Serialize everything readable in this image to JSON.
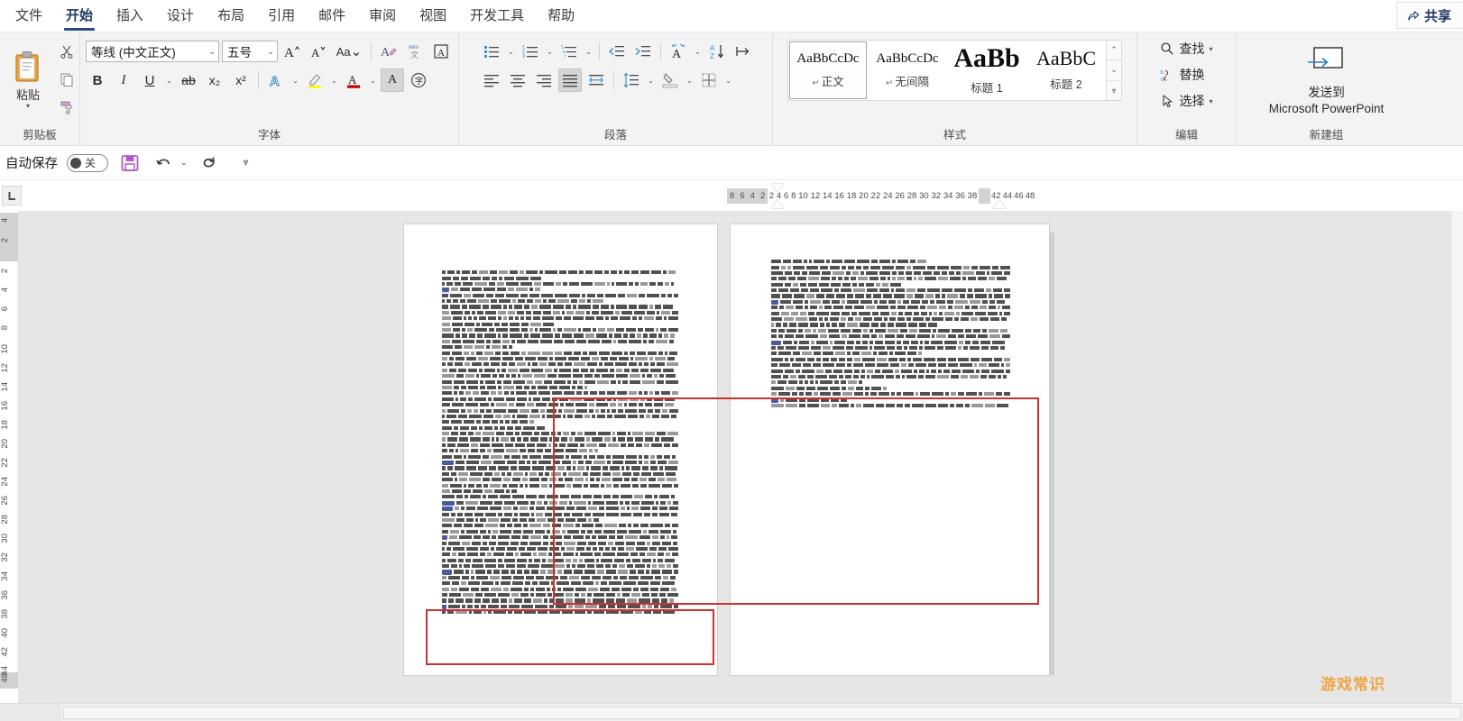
{
  "window": {
    "share_label": "共享"
  },
  "tabs": [
    {
      "label": "文件",
      "active": false
    },
    {
      "label": "开始",
      "active": true
    },
    {
      "label": "插入",
      "active": false
    },
    {
      "label": "设计",
      "active": false
    },
    {
      "label": "布局",
      "active": false
    },
    {
      "label": "引用",
      "active": false
    },
    {
      "label": "邮件",
      "active": false
    },
    {
      "label": "审阅",
      "active": false
    },
    {
      "label": "视图",
      "active": false
    },
    {
      "label": "开发工具",
      "active": false
    },
    {
      "label": "帮助",
      "active": false
    }
  ],
  "ribbon": {
    "clipboard": {
      "group_label": "剪贴板",
      "paste_label": "粘贴",
      "cut_icon": "scissors-icon",
      "copy_icon": "copy-icon",
      "format_painter_icon": "format-painter-icon"
    },
    "font": {
      "group_label": "字体",
      "font_name": "等线 (中文正文)",
      "font_size": "五号",
      "grow_font": "A▲",
      "shrink_font": "A▼",
      "change_case": "Aa",
      "clear_formatting_icon": "clear-formatting-icon",
      "phonetic_guide_icon": "phonetic-guide-icon",
      "character_border_icon": "character-border-icon",
      "bold": "B",
      "italic": "I",
      "underline": "U",
      "strikethrough": "ab",
      "subscript": "x₂",
      "superscript": "x²",
      "text_effects_icon": "text-effects-icon",
      "highlight_icon": "highlight-icon",
      "font_color_icon": "font-color-icon",
      "font_color_hex": "#C00000",
      "highlight_hex": "#FFFF00",
      "shading_icon": "character-shading-icon",
      "enclose_char_icon": "enclose-character-icon"
    },
    "paragraph": {
      "group_label": "段落",
      "bullets_icon": "bullet-list-icon",
      "numbering_icon": "numbered-list-icon",
      "multilevel_icon": "multilevel-list-icon",
      "decrease_indent_icon": "decrease-indent-icon",
      "increase_indent_icon": "increase-indent-icon",
      "chinese_layout_icon": "chinese-layout-icon",
      "sort_icon": "sort-icon",
      "show_marks_icon": "show-formatting-marks-icon",
      "align_left_icon": "align-left-icon",
      "align_center_icon": "align-center-icon",
      "align_right_icon": "align-right-icon",
      "justify_icon": "justify-icon",
      "distribute_icon": "distribute-icon",
      "line_spacing_icon": "line-spacing-icon",
      "shading_icon": "paragraph-shading-icon",
      "borders_icon": "borders-icon",
      "active_alignment": "justify"
    },
    "styles": {
      "group_label": "样式",
      "items": [
        {
          "preview": "AaBbCcDc",
          "name": "正文",
          "pilcrow": "↵",
          "selected": true,
          "size": "15px",
          "weight": "normal"
        },
        {
          "preview": "AaBbCcDc",
          "name": "无间隔",
          "pilcrow": "↵",
          "selected": false,
          "size": "15px",
          "weight": "normal"
        },
        {
          "preview": "AaBb",
          "name": "标题 1",
          "pilcrow": "",
          "selected": false,
          "size": "30px",
          "weight": "bold"
        },
        {
          "preview": "AaBbC",
          "name": "标题 2",
          "pilcrow": "",
          "selected": false,
          "size": "22px",
          "weight": "normal"
        }
      ]
    },
    "editing": {
      "group_label": "编辑",
      "find": "查找",
      "replace": "替换",
      "select": "选择"
    },
    "newgroup": {
      "group_label": "新建组",
      "send_to_line1": "发送到",
      "send_to_line2": "Microsoft PowerPoint",
      "icon": "send-to-powerpoint-icon"
    }
  },
  "quick_access": {
    "autosave_label": "自动保存",
    "autosave_state": "关",
    "save_icon": "save-icon",
    "save_color": "#B05BC9",
    "undo_icon": "undo-icon",
    "redo_icon": "redo-icon",
    "customize_icon": "customize-qat-icon"
  },
  "ruler": {
    "tab_stop_icon": "left-tab-stop-icon",
    "left_margin_numbers": [
      "8",
      "6",
      "4",
      "2"
    ],
    "body_numbers": [
      "2",
      "4",
      "6",
      "8",
      "10",
      "12",
      "14",
      "16",
      "18",
      "20",
      "22",
      "24",
      "26",
      "28",
      "30",
      "32",
      "34",
      "36",
      "38"
    ],
    "right_margin_numbers": [
      "42",
      "44",
      "46",
      "48"
    ],
    "vertical_numbers_grey": [
      "4",
      "2"
    ],
    "vertical_numbers": [
      "2",
      "4",
      "6",
      "8",
      "10",
      "12",
      "14",
      "16",
      "18",
      "20",
      "22",
      "24",
      "26",
      "28",
      "30",
      "32",
      "34",
      "36",
      "38",
      "40",
      "42",
      "44"
    ],
    "vertical_bottom_number": "48"
  },
  "document": {
    "page_count": 2,
    "annotation_color": "#D03030",
    "page1_label": "page-1",
    "page2_label": "page-2"
  },
  "watermark": {
    "text": "游戏常识",
    "color": "#F0A13A"
  },
  "chart_data": null
}
